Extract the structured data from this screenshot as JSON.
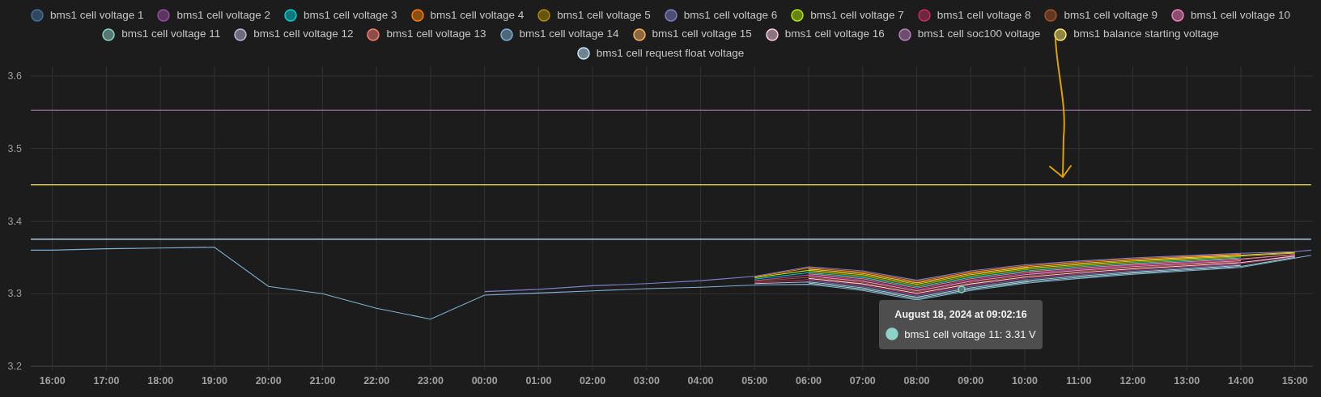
{
  "chart_data": {
    "type": "line",
    "grid": true,
    "x": [
      "2024-08-17T15:36",
      "2024-08-17T16:00",
      "2024-08-17T17:00",
      "2024-08-17T18:00",
      "2024-08-17T19:00",
      "2024-08-17T20:00",
      "2024-08-17T21:00",
      "2024-08-17T22:00",
      "2024-08-17T23:00",
      "2024-08-18T00:00",
      "2024-08-18T01:00",
      "2024-08-18T02:00",
      "2024-08-18T03:00",
      "2024-08-18T04:00",
      "2024-08-18T05:00",
      "2024-08-18T06:00",
      "2024-08-18T07:00",
      "2024-08-18T08:00",
      "2024-08-18T09:00",
      "2024-08-18T10:00",
      "2024-08-18T11:00",
      "2024-08-18T12:00",
      "2024-08-18T13:00",
      "2024-08-18T14:00",
      "2024-08-18T15:00",
      "2024-08-18T15:18"
    ],
    "xlim": [
      "2024-08-17T15:36",
      "2024-08-18T15:20"
    ],
    "ylim": [
      3.2,
      3.6
    ],
    "xticks": [
      {
        "value": "2024-08-17T16:00",
        "label": "16:00"
      },
      {
        "value": "2024-08-17T17:00",
        "label": "17:00"
      },
      {
        "value": "2024-08-17T18:00",
        "label": "18:00"
      },
      {
        "value": "2024-08-17T19:00",
        "label": "19:00"
      },
      {
        "value": "2024-08-17T20:00",
        "label": "20:00"
      },
      {
        "value": "2024-08-17T21:00",
        "label": "21:00"
      },
      {
        "value": "2024-08-17T22:00",
        "label": "22:00"
      },
      {
        "value": "2024-08-17T23:00",
        "label": "23:00"
      },
      {
        "value": "2024-08-18T00:00",
        "label": "00:00"
      },
      {
        "value": "2024-08-18T01:00",
        "label": "01:00"
      },
      {
        "value": "2024-08-18T02:00",
        "label": "02:00"
      },
      {
        "value": "2024-08-18T03:00",
        "label": "03:00"
      },
      {
        "value": "2024-08-18T04:00",
        "label": "04:00"
      },
      {
        "value": "2024-08-18T05:00",
        "label": "05:00"
      },
      {
        "value": "2024-08-18T06:00",
        "label": "06:00"
      },
      {
        "value": "2024-08-18T07:00",
        "label": "07:00"
      },
      {
        "value": "2024-08-18T08:00",
        "label": "08:00"
      },
      {
        "value": "2024-08-18T09:00",
        "label": "09:00"
      },
      {
        "value": "2024-08-18T10:00",
        "label": "10:00"
      },
      {
        "value": "2024-08-18T11:00",
        "label": "11:00"
      },
      {
        "value": "2024-08-18T12:00",
        "label": "12:00"
      },
      {
        "value": "2024-08-18T13:00",
        "label": "13:00"
      },
      {
        "value": "2024-08-18T14:00",
        "label": "14:00"
      },
      {
        "value": "2024-08-18T15:00",
        "label": "15:00"
      }
    ],
    "yticks": [
      {
        "value": 3.2,
        "label": "3.2"
      },
      {
        "value": 3.3,
        "label": "3.3"
      },
      {
        "value": 3.4,
        "label": "3.4"
      },
      {
        "value": 3.5,
        "label": "3.5"
      },
      {
        "value": 3.6,
        "label": "3.6"
      }
    ],
    "series": [
      {
        "name": "bms1 cell voltage 1",
        "color": "#44739e",
        "values": [
          null,
          null,
          null,
          null,
          null,
          null,
          null,
          null,
          null,
          null,
          null,
          null,
          null,
          null,
          null,
          3.3178,
          3.3099,
          3.2969,
          3.3099,
          3.3194,
          3.3258,
          3.3313,
          3.3357,
          3.3402,
          null,
          null
        ]
      },
      {
        "name": "bms1 cell voltage 2",
        "color": "#984ea3",
        "values": [
          null,
          null,
          null,
          null,
          null,
          null,
          null,
          null,
          null,
          null,
          null,
          null,
          null,
          null,
          3.318,
          3.3258,
          3.3189,
          3.3059,
          3.3189,
          3.3279,
          3.3338,
          3.3388,
          3.3427,
          3.3467,
          3.354,
          null
        ]
      },
      {
        "name": "bms1 cell voltage 3",
        "color": "#00d2d5",
        "values": [
          null,
          null,
          null,
          null,
          null,
          null,
          null,
          null,
          null,
          null,
          null,
          null,
          null,
          null,
          3.32,
          3.329,
          3.3225,
          3.3095,
          3.3225,
          3.3313,
          3.337,
          3.3418,
          3.3455,
          3.3493,
          null,
          null
        ]
      },
      {
        "name": "bms1 cell voltage 4",
        "color": "#ff7f00",
        "values": [
          null,
          null,
          null,
          null,
          null,
          null,
          null,
          null,
          null,
          null,
          null,
          null,
          null,
          null,
          3.323,
          3.3354,
          3.3297,
          3.3167,
          3.3297,
          3.3381,
          3.3434,
          3.3478,
          3.3511,
          3.3545,
          null,
          null
        ]
      },
      {
        "name": "bms1 cell voltage 5",
        "color": "#af8d00",
        "values": [
          null,
          null,
          null,
          null,
          null,
          null,
          null,
          null,
          null,
          null,
          null,
          null,
          null,
          null,
          null,
          3.3306,
          3.3243,
          3.3113,
          3.3243,
          3.333,
          3.3386,
          3.3433,
          3.3469,
          3.3506,
          null,
          null
        ]
      },
      {
        "name": "bms1 cell voltage 6",
        "color": "#7f80cd",
        "values": [
          null,
          null,
          null,
          null,
          null,
          null,
          null,
          null,
          null,
          3.303,
          3.306,
          3.311,
          3.314,
          3.318,
          3.324,
          3.337,
          3.3315,
          3.3185,
          3.3315,
          3.3398,
          3.345,
          3.3493,
          3.3525,
          3.3558,
          3.358,
          3.36
        ]
      },
      {
        "name": "bms1 cell voltage 7",
        "color": "#b3e900",
        "values": [
          null,
          null,
          null,
          null,
          null,
          null,
          null,
          null,
          null,
          null,
          null,
          null,
          null,
          null,
          3.322,
          3.3322,
          3.3261,
          3.3131,
          3.3261,
          3.3347,
          3.3402,
          3.3448,
          3.3483,
          3.3519,
          3.356,
          null
        ]
      },
      {
        "name": "bms1 cell voltage 8",
        "color": "#c42e60",
        "values": [
          null,
          null,
          null,
          null,
          null,
          null,
          null,
          null,
          null,
          null,
          null,
          null,
          null,
          null,
          3.315,
          3.3194,
          3.3117,
          3.2987,
          3.3117,
          3.3211,
          3.3274,
          3.3328,
          3.3371,
          3.3415,
          3.351,
          null
        ]
      },
      {
        "name": "bms1 cell voltage 9",
        "color": "#a65628",
        "values": [
          null,
          null,
          null,
          null,
          null,
          null,
          null,
          null,
          null,
          null,
          null,
          null,
          null,
          null,
          3.317,
          3.3226,
          3.3153,
          3.3023,
          3.3153,
          3.3245,
          3.3306,
          3.3358,
          3.3399,
          3.3441,
          null,
          null
        ]
      },
      {
        "name": "bms1 cell voltage 10",
        "color": "#f781bf",
        "values": [
          null,
          null,
          null,
          null,
          null,
          null,
          null,
          null,
          null,
          null,
          null,
          null,
          null,
          null,
          null,
          3.3242,
          3.3171,
          3.3041,
          3.3171,
          3.3262,
          3.3322,
          3.3373,
          3.3413,
          3.3454,
          null,
          null
        ]
      },
      {
        "name": "bms1 cell voltage 11",
        "color": "#8dd3c7",
        "values": [
          null,
          null,
          null,
          null,
          null,
          null,
          null,
          null,
          null,
          null,
          null,
          null,
          null,
          null,
          null,
          3.3146,
          3.3063,
          3.2933,
          3.3063,
          3.316,
          3.3226,
          3.3283,
          3.3329,
          3.3376,
          3.35,
          null
        ]
      },
      {
        "name": "bms1 cell voltage 12",
        "color": "#bebada",
        "values": [
          null,
          null,
          null,
          null,
          null,
          null,
          null,
          null,
          null,
          null,
          null,
          null,
          null,
          null,
          3.314,
          3.3162,
          3.3081,
          3.2951,
          3.3081,
          3.3177,
          3.3242,
          3.3298,
          3.3343,
          3.3389,
          null,
          null
        ]
      },
      {
        "name": "bms1 cell voltage 13",
        "color": "#fb8072",
        "values": [
          null,
          null,
          null,
          null,
          null,
          null,
          null,
          null,
          null,
          null,
          null,
          null,
          null,
          null,
          null,
          3.3274,
          3.3207,
          3.3077,
          3.3207,
          3.3296,
          3.3354,
          3.3403,
          3.3441,
          3.348,
          3.354,
          null
        ]
      },
      {
        "name": "bms1 cell voltage 14",
        "color": "#80b1d3",
        "values": [
          3.36,
          3.36,
          3.362,
          3.363,
          3.364,
          3.31,
          3.3,
          3.28,
          3.265,
          3.298,
          3.301,
          3.304,
          3.307,
          3.309,
          3.312,
          3.313,
          3.3045,
          3.2915,
          3.3045,
          3.3143,
          3.321,
          3.3268,
          3.3315,
          3.3363,
          3.349,
          3.353
        ]
      },
      {
        "name": "bms1 cell voltage 15",
        "color": "#fdb462",
        "values": [
          null,
          null,
          null,
          null,
          null,
          null,
          null,
          null,
          null,
          null,
          null,
          null,
          null,
          null,
          null,
          3.3338,
          3.3279,
          3.3149,
          3.3279,
          3.3364,
          3.3418,
          3.3463,
          3.3497,
          3.3532,
          3.357,
          null
        ]
      },
      {
        "name": "bms1 cell voltage 16",
        "color": "#fccde5",
        "values": [
          null,
          null,
          null,
          null,
          null,
          null,
          null,
          null,
          null,
          null,
          null,
          null,
          null,
          null,
          null,
          3.321,
          3.3135,
          3.3005,
          3.3135,
          3.3228,
          3.329,
          3.3343,
          3.3385,
          3.3428,
          3.352,
          null
        ]
      },
      {
        "name": "bms1 cell soc100 voltage",
        "color": "#bc80bd",
        "values": [
          3.553,
          3.553,
          3.553,
          3.553,
          3.553,
          3.553,
          3.553,
          3.553,
          3.553,
          3.553,
          3.553,
          3.553,
          3.553,
          3.553,
          3.553,
          3.553,
          3.553,
          3.553,
          3.553,
          3.553,
          3.553,
          3.553,
          3.553,
          3.553,
          3.553,
          3.553
        ]
      },
      {
        "name": "bms1 balance starting voltage",
        "color": "#ffed6f",
        "values": [
          3.45,
          3.45,
          3.45,
          3.45,
          3.45,
          3.45,
          3.45,
          3.45,
          3.45,
          3.45,
          3.45,
          3.45,
          3.45,
          3.45,
          3.45,
          3.45,
          3.45,
          3.45,
          3.45,
          3.45,
          3.45,
          3.45,
          3.45,
          3.45,
          3.45,
          3.45
        ]
      },
      {
        "name": "bms1 cell request float voltage",
        "color": "#c4eaff",
        "values": [
          3.375,
          3.375,
          3.375,
          3.375,
          3.375,
          3.375,
          3.375,
          3.375,
          3.375,
          3.375,
          3.375,
          3.375,
          3.375,
          3.375,
          3.375,
          3.375,
          3.375,
          3.375,
          3.375,
          3.375,
          3.375,
          3.375,
          3.375,
          3.375,
          3.375,
          3.375
        ]
      }
    ]
  },
  "tooltip": {
    "title": "August 18, 2024 at 09:02:16",
    "label": "bms1 cell voltage 11: 3.31 V",
    "color": "#8dd3c7"
  }
}
